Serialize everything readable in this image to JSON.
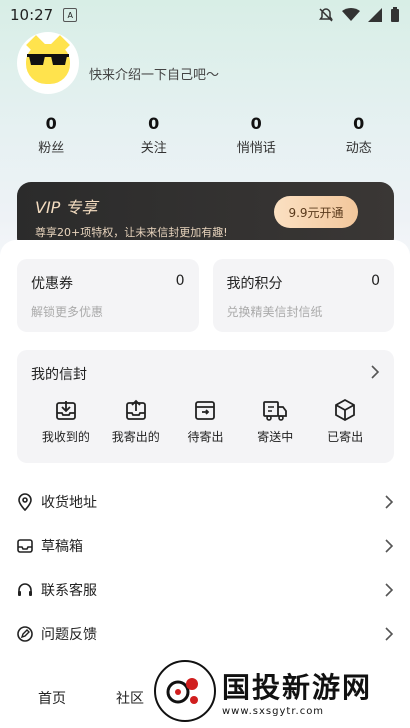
{
  "status": {
    "time": "10:27"
  },
  "profile": {
    "bio": "快来介绍一下自己吧～"
  },
  "stats": [
    {
      "num": "0",
      "label": "粉丝"
    },
    {
      "num": "0",
      "label": "关注"
    },
    {
      "num": "0",
      "label": "悄悄话"
    },
    {
      "num": "0",
      "label": "动态"
    }
  ],
  "vip": {
    "title": "VIP 专享",
    "subtitle": "尊享20+项特权，让未来信封更加有趣!",
    "button": "9.9元开通"
  },
  "cards": [
    {
      "title": "优惠券",
      "value": "0",
      "subtitle": "解锁更多优惠"
    },
    {
      "title": "我的积分",
      "value": "0",
      "subtitle": "兑换精美信封信纸"
    }
  ],
  "letters": {
    "title": "我的信封",
    "items": [
      "我收到的",
      "我寄出的",
      "待寄出",
      "寄送中",
      "已寄出"
    ]
  },
  "menu": [
    "收货地址",
    "草稿箱",
    "联系客服",
    "问题反馈"
  ],
  "tabs": [
    "首页",
    "社区"
  ],
  "watermark": {
    "title": "国投新游网",
    "url": "www.sxsgytr.com"
  }
}
